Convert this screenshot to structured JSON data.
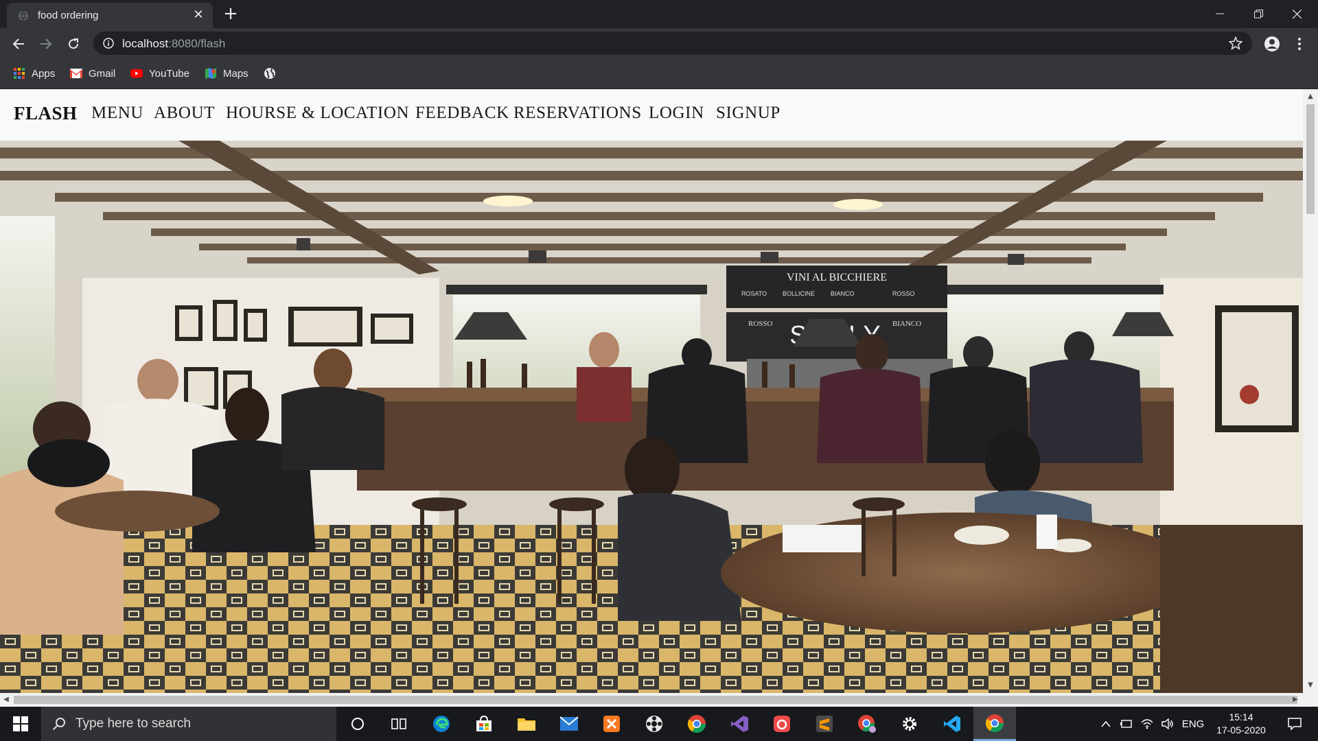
{
  "browser": {
    "tab_title": "food ordering",
    "url_host": "localhost",
    "url_path": ":8080/flash",
    "bookmarks": [
      "Apps",
      "Gmail",
      "YouTube",
      "Maps"
    ]
  },
  "site": {
    "brand": "FLASH",
    "nav": [
      "MENU",
      "ABOUT",
      "HOURSE & LOCATION",
      "FEEDBACK",
      "RESERVATIONS",
      "LOGIN",
      "SIGNUP"
    ],
    "hero_signs": {
      "wine_board": "VINI AL BICCHIERE",
      "wine_cols": [
        "ROSATO",
        "BOLLICINE",
        "BIANCO",
        "ROSSO"
      ],
      "sicily_board": "SICILY",
      "sicily_left": "ROSSO",
      "sicily_right": "BIANCO"
    }
  },
  "taskbar": {
    "search_placeholder": "Type here to search",
    "language": "ENG",
    "time": "15:14",
    "date": "17-05-2020"
  },
  "colors": {
    "chrome_dark": "#202124",
    "chrome_toolbar": "#35363a",
    "nav_bg": "#f8f9fa",
    "taskbar": "#17191d"
  }
}
